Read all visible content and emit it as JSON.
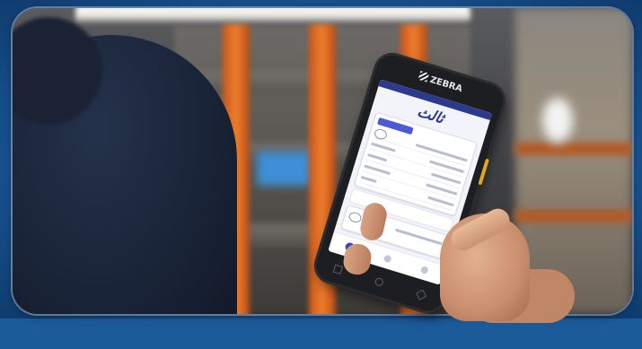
{
  "scene": {
    "description_colors": {
      "frame": "#1c5b9a",
      "beam": "#f07f2c",
      "app_accent": "#2d3a8c",
      "device_key": "#e0a81e"
    }
  },
  "device": {
    "brand": "ZEBRA",
    "icons": [
      "zebra-logo-icon",
      "home-icon",
      "back-icon",
      "recents-icon"
    ]
  },
  "app": {
    "logo_text": "ثالث"
  }
}
